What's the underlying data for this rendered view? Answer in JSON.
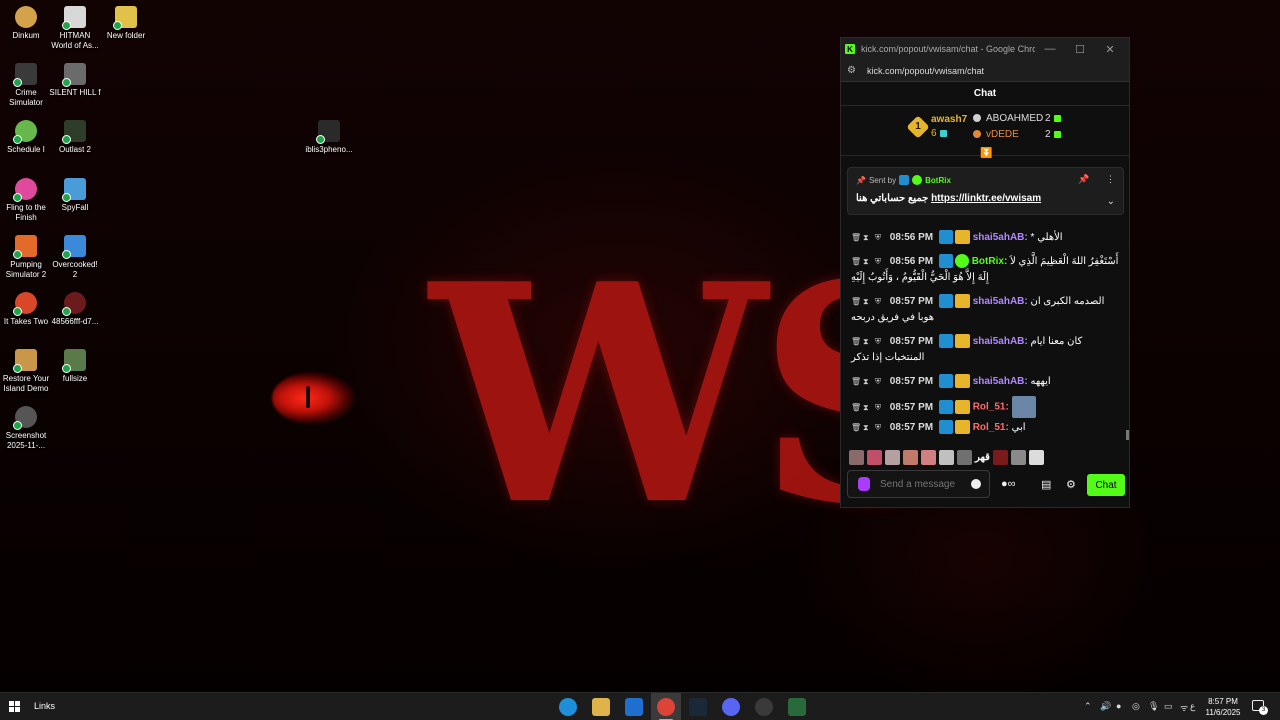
{
  "desktop": {
    "icons": [
      {
        "label": "Dinkum",
        "color": "#d4a24a"
      },
      {
        "label": "HITMAN World of As...",
        "color": "#d8d8d8"
      },
      {
        "label": "New folder",
        "color": "#e0c14a"
      },
      {
        "label": "Crime Simulator",
        "color": "#3a3a3a"
      },
      {
        "label": "SILENT HILL f",
        "color": "#6b6b6b"
      },
      {
        "label": "Schedule I",
        "color": "#67b84a"
      },
      {
        "label": "Outlast 2",
        "color": "#2e3d2a"
      },
      {
        "label": "Fling to the Finish",
        "color": "#e04a9c"
      },
      {
        "label": "SpyFall",
        "color": "#4a9cd9"
      },
      {
        "label": "Pumping Simulator 2",
        "color": "#e36b2a"
      },
      {
        "label": "Overcooked! 2",
        "color": "#3a8ad9"
      },
      {
        "label": "It Takes Two",
        "color": "#d9472a"
      },
      {
        "label": "48566fff-d7...",
        "color": "#6b1b1b"
      },
      {
        "label": "Restore Your Island Demo",
        "color": "#c9974a"
      },
      {
        "label": "fullsize",
        "color": "#5a7a4a"
      },
      {
        "label": "Screenshot 2025-11-...",
        "color": "#555555"
      },
      {
        "label": "iblis3pheno...",
        "color": "#2a2a2a"
      }
    ],
    "wallpaper_text": "WS"
  },
  "chrome": {
    "window_title": "kick.com/popout/vwisam/chat - Google Chrome",
    "address": "kick.com/popout/vwisam/chat",
    "minimize": "—",
    "maximize": "☐",
    "close": "✕"
  },
  "chat": {
    "header": "Chat",
    "leaderboard": {
      "first": {
        "rank": "1",
        "name": "awash7",
        "count": "6"
      },
      "second": {
        "name": "ABOAHMED",
        "count": "2"
      },
      "third": {
        "name": "vDEDE",
        "count": "2"
      }
    },
    "pinned": {
      "sent_by_label": "Sent by",
      "bot_name": "BotRix",
      "text_prefix": "جميع حساباتي هنا",
      "link": "https://linktr.ee/vwisam"
    },
    "messages": [
      {
        "time": "08:56 PM",
        "user": "shai5ahAB",
        "text": "* الأهلي"
      },
      {
        "time": "08:56 PM",
        "user": "BotRix",
        "text": "أَسْتَغْفِرُ اللهَ الْعَظِيمَ الَّذِي لاَ إِلَهَ إِلاَّ هُوَ الْحَيُّ الْقَيُّومُ ، وَأَتُوبُ إِلَيْهِ"
      },
      {
        "time": "08:57 PM",
        "user": "shai5ahAB",
        "text": "الصدمه الكبرى ان هوبا في فريق دربحه"
      },
      {
        "time": "08:57 PM",
        "user": "shai5ahAB",
        "text": "كان معنا ايام المنتخبات إذا تذكر"
      },
      {
        "time": "08:57 PM",
        "user": "shai5ahAB",
        "text": "ايههه"
      },
      {
        "time": "08:57 PM",
        "user": "Rol_51",
        "text": ""
      },
      {
        "time": "08:57 PM",
        "user": "Rol_51",
        "text": "ابي"
      }
    ],
    "emote_text": "قهر",
    "input_placeholder": "Send a message",
    "send_label": "Chat"
  },
  "taskbar": {
    "links_label": "Links",
    "time": "8:57 PM",
    "date": "11/6/2025",
    "lang": "ع",
    "notif_count": "3"
  }
}
